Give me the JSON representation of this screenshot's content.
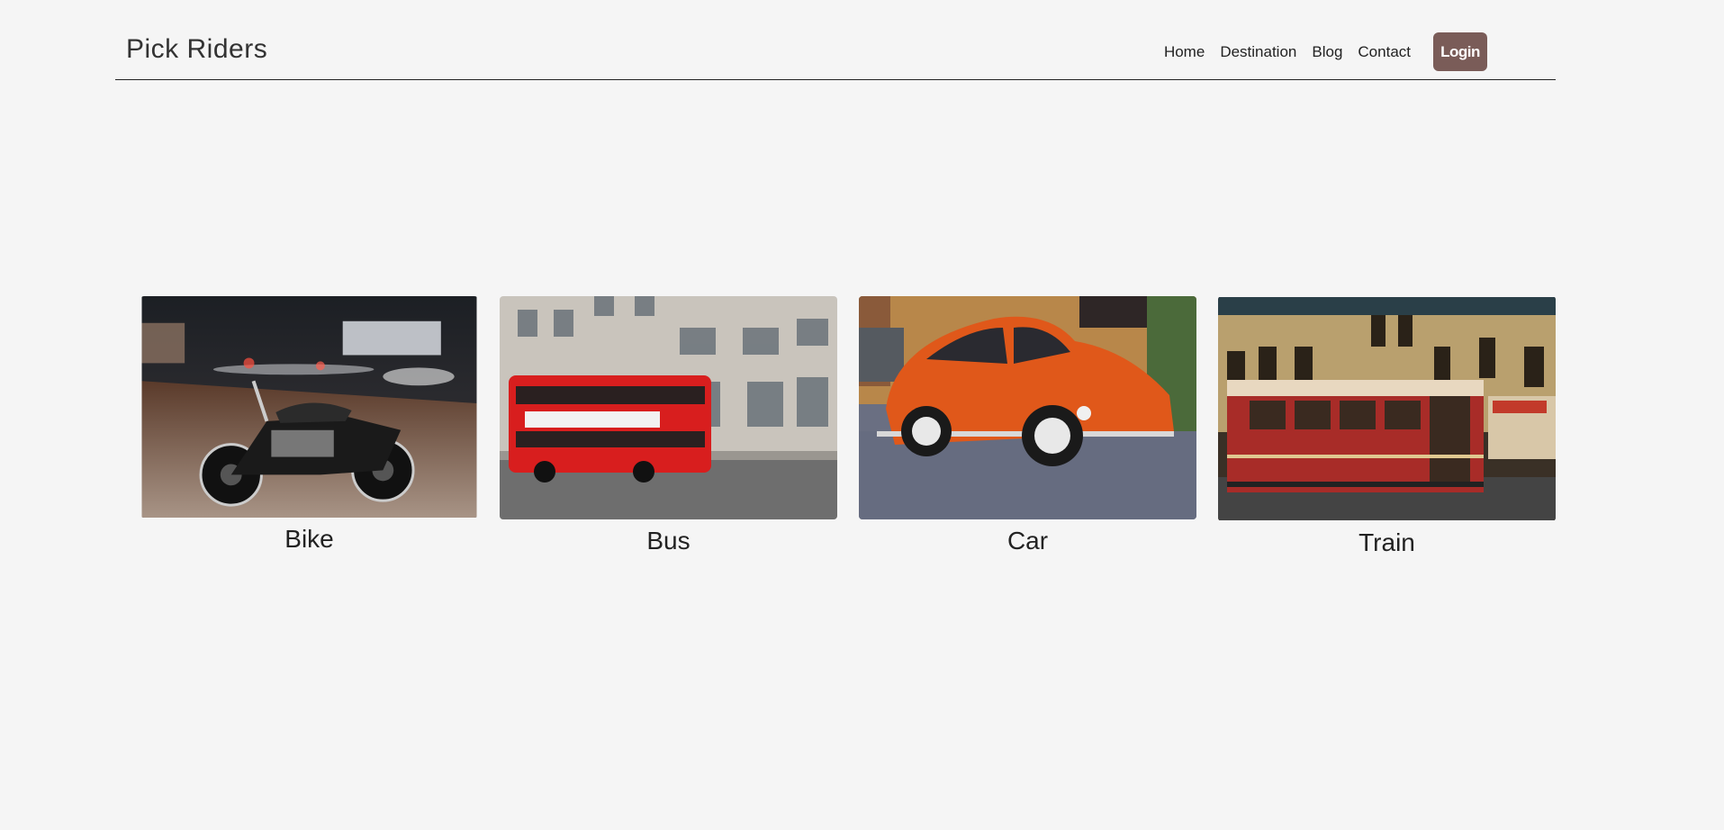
{
  "brand": {
    "title": "Pick Riders"
  },
  "nav": {
    "links": [
      "Home",
      "Destination",
      "Blog",
      "Contact"
    ],
    "login_label": "Login"
  },
  "cards": [
    {
      "label": "Bike",
      "image": "motorcycle-photo"
    },
    {
      "label": "Bus",
      "image": "double-decker-bus-photo"
    },
    {
      "label": "Car",
      "image": "orange-beetle-car-photo"
    },
    {
      "label": "Train",
      "image": "red-tram-photo"
    }
  ],
  "colors": {
    "background": "#f5f5f5",
    "login_button": "#7a5c58",
    "text": "#222222"
  }
}
